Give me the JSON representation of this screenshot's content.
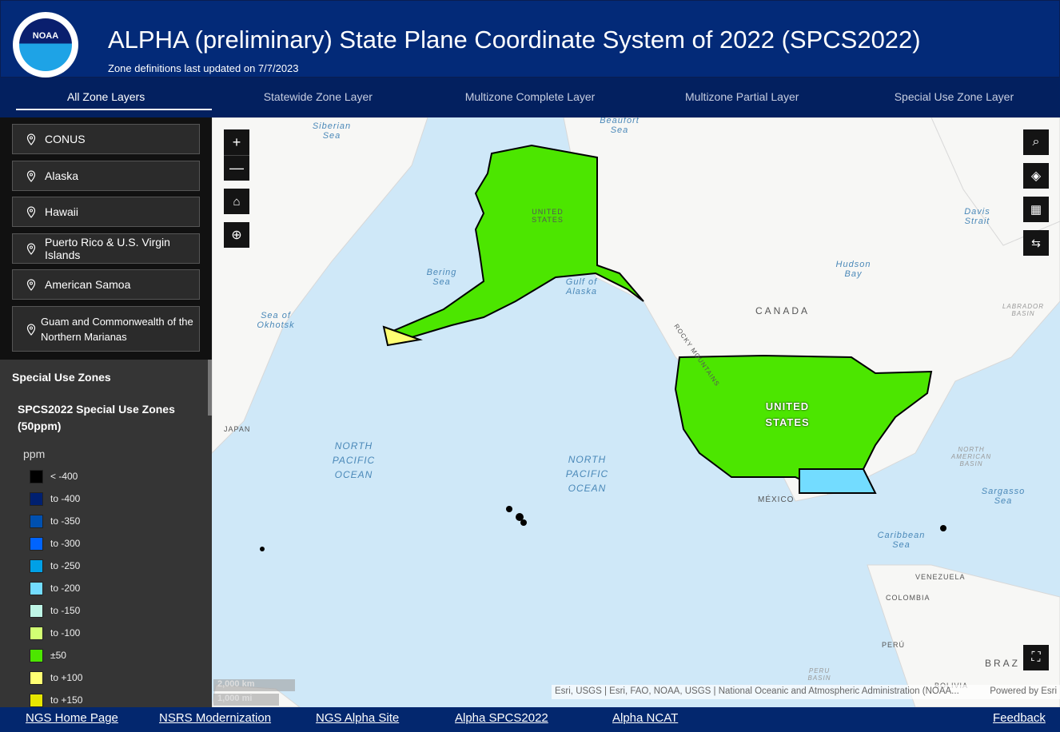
{
  "header": {
    "title": "ALPHA (preliminary) State Plane Coordinate System of 2022 (SPCS2022)",
    "subtitle": "Zone definitions last updated on 7/7/2023",
    "logo_text": "NOAA"
  },
  "tabs": [
    {
      "label": "All Zone Layers",
      "active": true
    },
    {
      "label": "Statewide Zone Layer"
    },
    {
      "label": "Multizone Complete Layer"
    },
    {
      "label": "Multizone Partial Layer"
    },
    {
      "label": "Special Use Zone Layer"
    }
  ],
  "locations": [
    "CONUS",
    "Alaska",
    "Hawaii",
    "Puerto Rico & U.S. Virgin Islands",
    "American Samoa",
    "Guam and Commonwealth of the Northern Marianas"
  ],
  "legend": {
    "section": "Special Use Zones",
    "layer": "SPCS2022 Special Use Zones (50ppm)",
    "unit": "ppm",
    "items": [
      {
        "label": "< -400",
        "color": "#000000"
      },
      {
        "label": "to -400",
        "color": "#002070"
      },
      {
        "label": "to -350",
        "color": "#0050b0"
      },
      {
        "label": "to -300",
        "color": "#0064ff"
      },
      {
        "label": "to -250",
        "color": "#00a0e6"
      },
      {
        "label": "to -200",
        "color": "#73dcff"
      },
      {
        "label": "to -150",
        "color": "#bef5e6"
      },
      {
        "label": "to -100",
        "color": "#d2ff73"
      },
      {
        "label": "±50",
        "color": "#4ce600"
      },
      {
        "label": "to +100",
        "color": "#ffff73"
      },
      {
        "label": "to +150",
        "color": "#e6e600"
      }
    ]
  },
  "map": {
    "labels": {
      "siberian": "Siberian Sea",
      "beaufort": "Beaufort Sea",
      "bering": "Bering Sea",
      "gulf": "Gulf of Alaska",
      "okhotsk": "Sea of Okhotsk",
      "hudson": "Hudson Bay",
      "davis": "Davis Strait",
      "npo1": "NORTH PACIFIC OCEAN",
      "npo2": "NORTH PACIFIC OCEAN",
      "sargasso": "Sargasso Sea",
      "caribbean": "Caribbean Sea",
      "canada": "CANADA",
      "us_ak": "UNITED STATES",
      "us": "UNITED STATES",
      "mexico": "MÉXICO",
      "japan": "JAPAN",
      "venezuela": "VENEZUELA",
      "colombia": "COLOMBIA",
      "peru": "PERÚ",
      "bolivia": "BOLIVIA",
      "brazil": "BRAZ",
      "labrador": "LABRADOR BASIN",
      "nab": "NORTH AMERICAN BASIN",
      "peru_basin": "PERU BASIN",
      "rocky": "ROCKY MOUNTAINS"
    },
    "scale_km": "2,000 km",
    "scale_mi": "1,000 mi",
    "attribution": "Esri, USGS | Esri, FAO, NOAA, USGS | National Oceanic and Atmospheric Administration (NOAA...",
    "powered": "Powered by Esri"
  },
  "footer": [
    "NGS Home Page",
    "NSRS Modernization",
    "NGS Alpha Site",
    "Alpha SPCS2022",
    "Alpha NCAT",
    "Feedback"
  ]
}
